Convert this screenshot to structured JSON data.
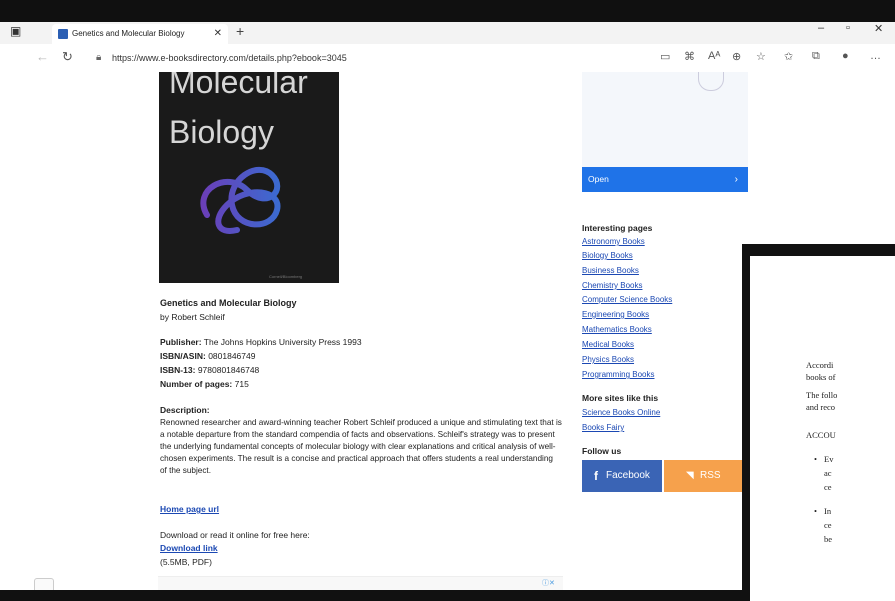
{
  "browser": {
    "tab_title": "Genetics and Molecular Biology",
    "tab_close": "✕",
    "new_tab": "+",
    "url": "https://www.e-booksdirectory.com/details.php?ebook=3045",
    "window_minimize": "–",
    "window_restore": "▫",
    "window_close": "✕"
  },
  "cover": {
    "line1": "Molecular",
    "line2": "Biology",
    "publisher_mark": "Cornell/Bloomberg"
  },
  "book": {
    "title": "Genetics and Molecular Biology",
    "author": "by Robert Schleif",
    "publisher_label": "Publisher:",
    "publisher": "The Johns Hopkins University Press 1993",
    "isbn_label": "ISBN/ASIN:",
    "isbn": "0801846749",
    "isbn13_label": "ISBN-13:",
    "isbn13": "9780801846748",
    "pages_label": "Number of pages:",
    "pages": "715",
    "description_label": "Description:",
    "description": "Renowned researcher and award-winning teacher Robert Schleif produced a unique and stimulating text that is a notable departure from the standard compendia of facts and observations. Schleif's strategy was to present the underlying fundamental concepts of molecular biology with clear explanations and critical analysis of well-chosen experiments. The result is a concise and practical approach that offers students a real understanding of the subject.",
    "home_page": "Home page url",
    "download_text": "Download or read it online for free here:",
    "download_link": "Download link",
    "download_size": "(5.5MB, PDF)"
  },
  "sidebar": {
    "open_button": "Open",
    "open_chevron": "›",
    "interesting_heading": "Interesting pages",
    "links": [
      "Astronomy Books",
      "Biology Books",
      "Business Books",
      "Chemistry Books",
      "Computer Science Books",
      "Engineering Books",
      "Mathematics Books",
      "Medical Books",
      "Physics Books",
      "Programming Books"
    ],
    "more_sites_heading": "More sites like this",
    "more_sites": [
      "Science Books Online",
      "Books Fairy"
    ],
    "follow_heading": "Follow us",
    "facebook": "Facebook",
    "rss": "RSS"
  },
  "doc_window": {
    "line1": "Accordi",
    "line2": "books of",
    "line3": "The follo",
    "line4": "and reco",
    "line5": "ACCOU",
    "bullet1a": "Ev",
    "bullet1b": "ac",
    "bullet1c": "ce",
    "bullet2a": "In",
    "bullet2b": "ce",
    "bullet2c": "be"
  },
  "colors": {
    "open_button": "#1f73e8",
    "facebook": "#3a64b5",
    "rss": "#f6a14c",
    "link": "#1b48b3"
  }
}
